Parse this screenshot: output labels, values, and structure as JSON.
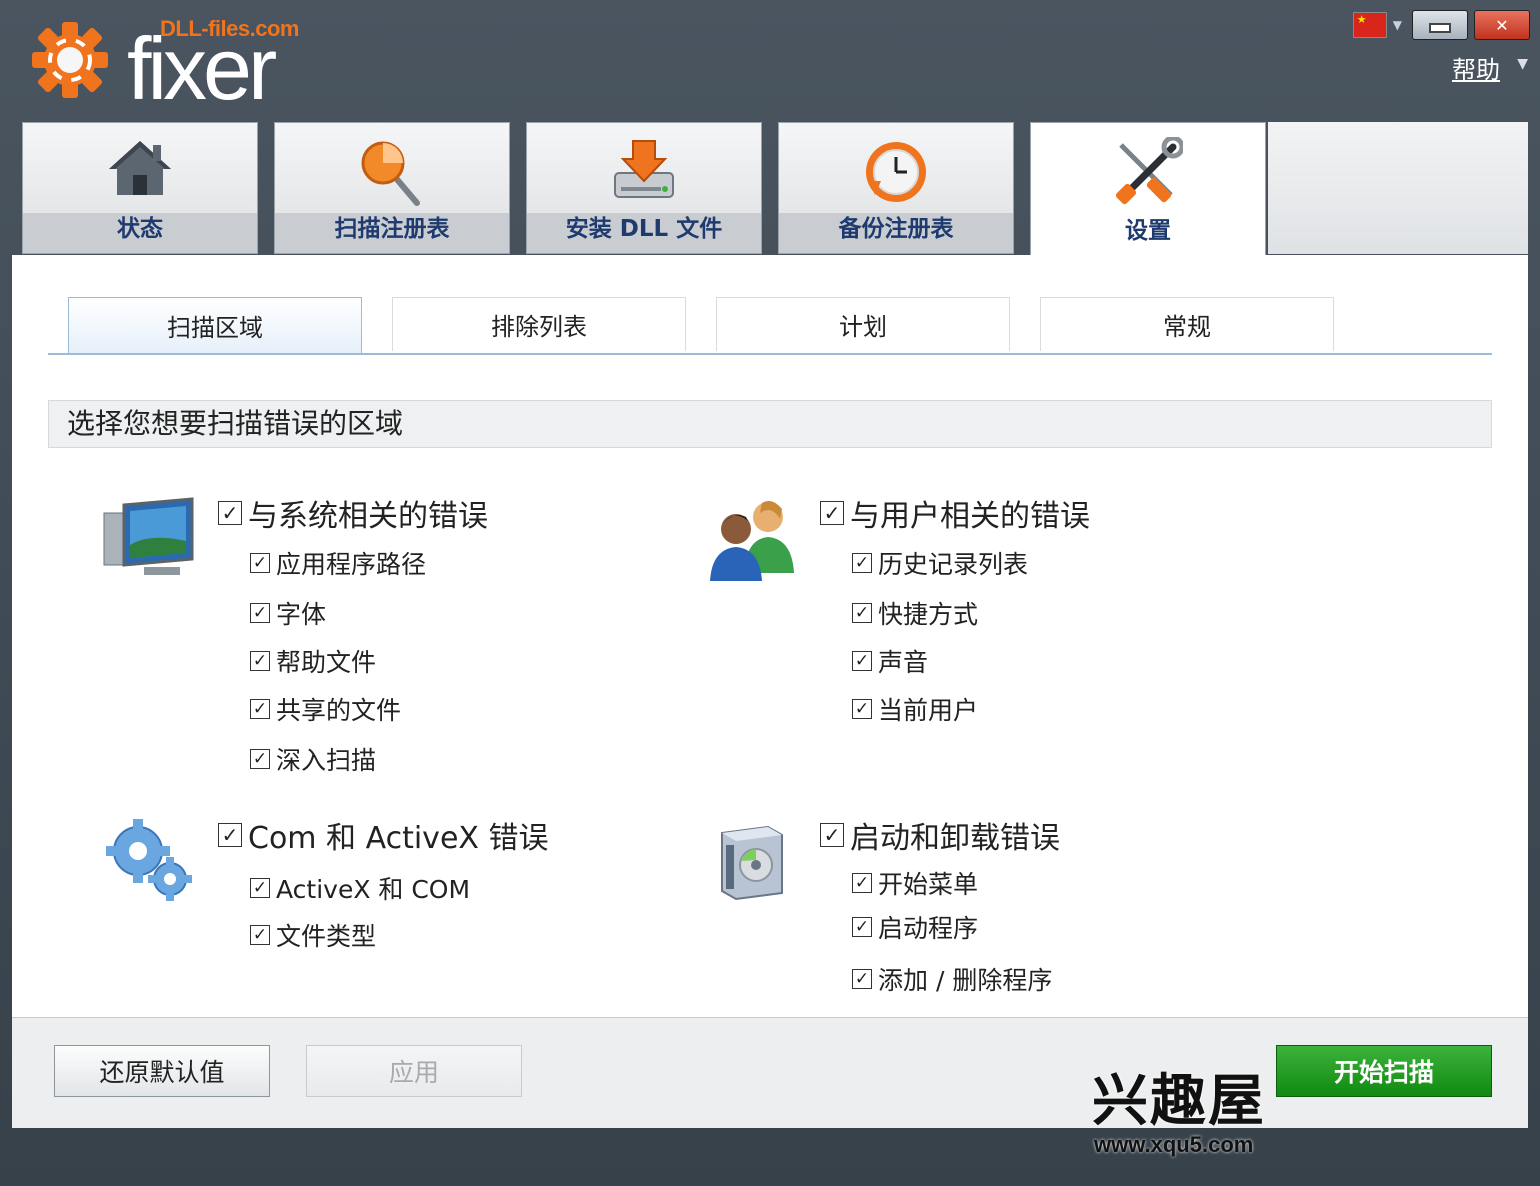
{
  "app": {
    "logo_sub": "DLL-files.com",
    "logo_word": "fixer"
  },
  "window": {
    "help_label": "帮助",
    "close_glyph": "✕"
  },
  "main_tabs": [
    {
      "label": "状态",
      "icon": "house-icon"
    },
    {
      "label": "扫描注册表",
      "icon": "magnifier-icon"
    },
    {
      "label": "安装 DLL 文件",
      "icon": "download-drive-icon"
    },
    {
      "label": "备份注册表",
      "icon": "clock-backup-icon"
    },
    {
      "label": "设置",
      "icon": "tools-icon",
      "active": true
    }
  ],
  "sub_tabs": [
    {
      "label": "扫描区域",
      "active": true
    },
    {
      "label": "排除列表"
    },
    {
      "label": "计划"
    },
    {
      "label": "常规"
    }
  ],
  "section_header": "选择您想要扫描错误的区域",
  "groups": {
    "system": {
      "title": "与系统相关的错误",
      "checked": true,
      "items": [
        {
          "label": "应用程序路径",
          "checked": true
        },
        {
          "label": "字体",
          "checked": true
        },
        {
          "label": "帮助文件",
          "checked": true
        },
        {
          "label": "共享的文件",
          "checked": true
        },
        {
          "label": "深入扫描",
          "checked": true
        }
      ]
    },
    "user": {
      "title": "与用户相关的错误",
      "checked": true,
      "items": [
        {
          "label": "历史记录列表",
          "checked": true
        },
        {
          "label": "快捷方式",
          "checked": true
        },
        {
          "label": "声音",
          "checked": true
        },
        {
          "label": "当前用户",
          "checked": true
        }
      ]
    },
    "com": {
      "title": "Com 和 ActiveX 错误",
      "checked": true,
      "items": [
        {
          "label": "ActiveX 和 COM",
          "checked": true
        },
        {
          "label": "文件类型",
          "checked": true
        }
      ]
    },
    "startup": {
      "title": "启动和卸载错误",
      "checked": true,
      "items": [
        {
          "label": "开始菜单",
          "checked": true
        },
        {
          "label": "启动程序",
          "checked": true
        },
        {
          "label": "添加 / 删除程序",
          "checked": true
        }
      ]
    }
  },
  "footer": {
    "restore_label": "还原默认值",
    "apply_label": "应用",
    "start_scan_label": "开始扫描"
  },
  "watermark": {
    "title": "兴趣屋",
    "url": "www.xqu5.com"
  },
  "colors": {
    "accent_orange": "#f0731e",
    "primary_green": "#1a9a1a",
    "tab_label": "#1e3a6e"
  }
}
